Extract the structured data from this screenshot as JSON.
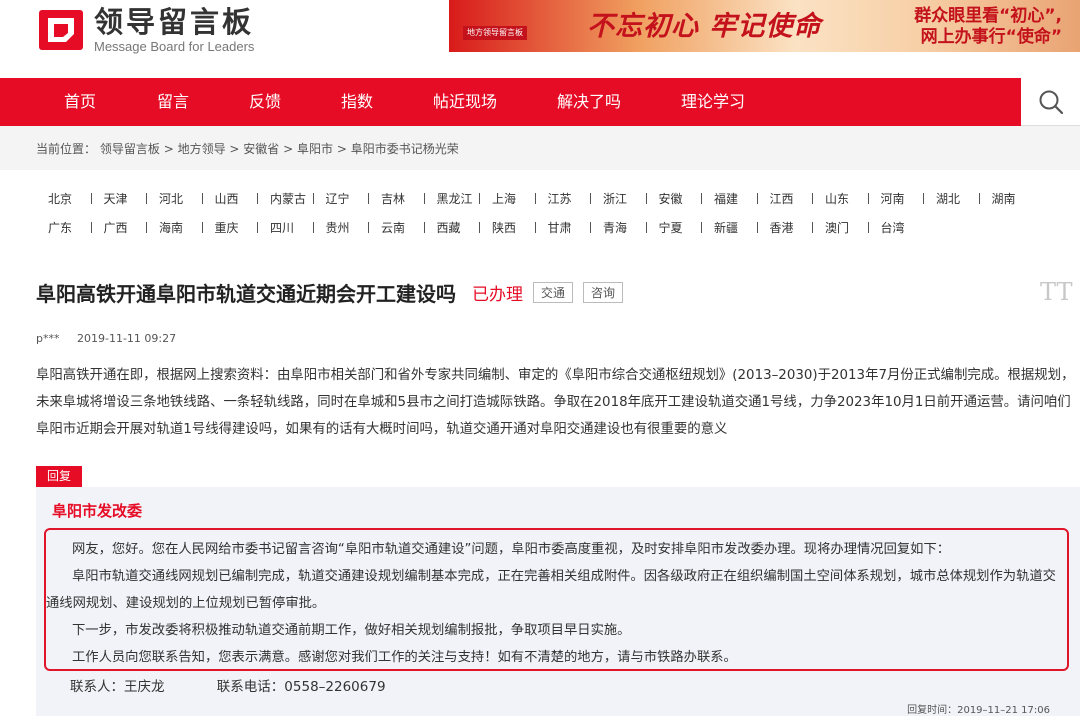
{
  "site": {
    "logo_title": "领导留言板",
    "logo_subtitle": "Message Board for Leaders"
  },
  "banner": {
    "badge": "地方领导留言板",
    "slogan": "不忘初心 牢记使命",
    "line1": "群众眼里看“初心”,",
    "line2": "网上办事行“使命”"
  },
  "nav": {
    "items": [
      "首页",
      "留言",
      "反馈",
      "指数",
      "帖近现场",
      "解决了吗",
      "理论学习"
    ],
    "search_icon": "search-icon"
  },
  "breadcrumb": {
    "prefix": "当前位置：",
    "items": [
      "领导留言板",
      "地方领导",
      "安徽省",
      "阜阳市",
      "阜阳市委书记杨光荣"
    ],
    "separator": " > "
  },
  "regions": {
    "row1": [
      "北京",
      "天津",
      "河北",
      "山西",
      "内蒙古",
      "辽宁",
      "吉林",
      "黑龙江",
      "上海",
      "江苏",
      "浙江",
      "安徽",
      "福建",
      "江西",
      "山东",
      "河南",
      "湖北",
      "湖南"
    ],
    "row2": [
      "广东",
      "广西",
      "海南",
      "重庆",
      "四川",
      "贵州",
      "云南",
      "西藏",
      "陕西",
      "甘肃",
      "青海",
      "宁夏",
      "新疆",
      "香港",
      "澳门",
      "台湾"
    ]
  },
  "post": {
    "title": "阜阳高铁开通阜阳市轨道交通近期会开工建设吗",
    "status": "已办理",
    "tags": [
      "交通",
      "咨询"
    ],
    "font_toggle": "TT",
    "author": "p***",
    "date": "2019-11-11 09:27",
    "body": "阜阳高铁开通在即，根据网上搜索资料：由阜阳市相关部门和省外专家共同编制、审定的《阜阳市综合交通枢纽规划》(2013–2030)于2013年7月份正式编制完成。根据规划，未来阜城将增设三条地铁线路、一条轻轨线路，同时在阜城和5县市之间打造城际铁路。争取在2018年底开工建设轨道交通1号线，力争2023年10月1日前开通运营。请问咱们阜阳市近期会开展对轨道1号线得建设吗，如果有的话有大概时间吗，轨道交通开通对阜阳交通建设也有很重要的意义"
  },
  "reply": {
    "label": "回复",
    "org": "阜阳市发改委",
    "paragraphs": [
      "网友，您好。您在人民网给市委书记留言咨询“阜阳市轨道交通建设”问题，阜阳市委高度重视，及时安排阜阳市发改委办理。现将办理情况回复如下：",
      "阜阳市轨道交通线网规划已编制完成，轨道交通建设规划编制基本完成，正在完善相关组成附件。因各级政府正在组织编制国土空间体系规划，城市总体规划作为轨道交通线网规划、建设规划的上位规划已暂停审批。",
      "下一步，市发改委将积极推动轨道交通前期工作，做好相关规划编制报批，争取项目早日实施。",
      "工作人员向您联系告知，您表示满意。感谢您对我们工作的关注与支持！如有不清楚的地方，请与市铁路办联系。"
    ],
    "contact_person": "联系人：王庆龙",
    "contact_phone": "联系电话：0558–2260679",
    "reply_time": "回复时间：2019–11–21 17:06"
  },
  "colors": {
    "brand_red": "#e60c26",
    "panel_bg": "#f2f3f8"
  }
}
